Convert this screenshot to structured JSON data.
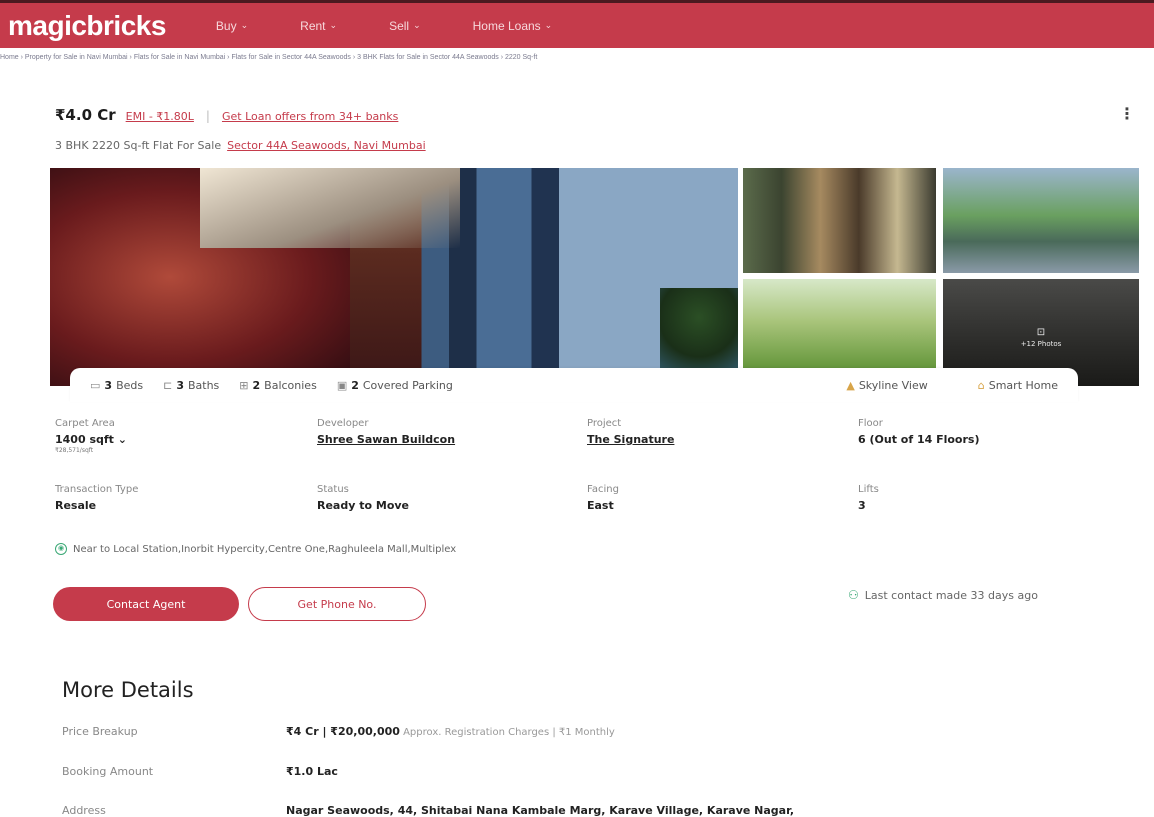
{
  "header": {
    "logo": "magicbricks",
    "nav": [
      {
        "label": "Buy",
        "chevron": "⌄"
      },
      {
        "label": "Rent",
        "chevron": "⌄"
      },
      {
        "label": "Sell",
        "chevron": "⌄"
      },
      {
        "label": "Home Loans",
        "chevron": "⌄"
      }
    ],
    "brand_color": "#c53b4b"
  },
  "breadcrumb": "Home › Property for Sale in Navi Mumbai › Flats for Sale in Navi Mumbai › Flats for Sale in Sector 44A Seawoods › 3 BHK Flats for Sale in Sector 44A Seawoods › 2220 Sq-ft",
  "listing": {
    "price": "₹4.0 Cr",
    "emi": "EMI - ₹1.80L",
    "separator": "|",
    "loan_offer": "Get Loan offers from 34+ banks",
    "menu_icon": "⋮",
    "subtitle": "3 BHK 2220 Sq-ft Flat For Sale",
    "location": "Sector 44A Seawoods, Navi Mumbai"
  },
  "gallery": {
    "more_photos": "+12 Photos",
    "camera_icon": "⊡"
  },
  "amenities": {
    "left": [
      {
        "icon": "bed-icon",
        "glyph": "▭",
        "count": "3",
        "label": "Beds"
      },
      {
        "icon": "bath-icon",
        "glyph": "⊏",
        "count": "3",
        "label": "Baths"
      },
      {
        "icon": "balcony-icon",
        "glyph": "⊞",
        "count": "2",
        "label": "Balconies"
      },
      {
        "icon": "parking-icon",
        "glyph": "▣",
        "count": "2",
        "label": "Covered Parking"
      }
    ],
    "right": [
      {
        "icon": "skyline-icon",
        "glyph": "▲",
        "label": "Skyline View"
      },
      {
        "icon": "smart-home-icon",
        "glyph": "⌂",
        "label": "Smart Home"
      }
    ]
  },
  "facts": [
    {
      "label": "Carpet Area",
      "value": "1400 sqft",
      "suffix": " ⌄",
      "sub": "₹28,571/sqft"
    },
    {
      "label": "Developer",
      "value": "Shree Sawan Buildcon",
      "link": true
    },
    {
      "label": "Project",
      "value": "The Signature",
      "link": true
    },
    {
      "label": "Floor",
      "value": "6 (Out of 14 Floors)"
    },
    {
      "label": "Transaction Type",
      "value": "Resale"
    },
    {
      "label": "Status",
      "value": "Ready to Move"
    },
    {
      "label": "Facing",
      "value": "East"
    },
    {
      "label": "Lifts",
      "value": "3"
    }
  ],
  "nearby": {
    "icon": "◉",
    "text": "Near to Local Station,Inorbit Hypercity,Centre One,Raghuleela Mall,Multiplex"
  },
  "actions": {
    "contact_agent": "Contact Agent",
    "get_phone": "Get Phone No.",
    "last_contact": "Last contact made 33 days ago",
    "person_icon": "⚇"
  },
  "more_details": {
    "title": "More Details",
    "rows": [
      {
        "label": "Price Breakup",
        "value": "₹4 Cr | ₹20,00,000",
        "muted": " Approx. Registration Charges | ₹1 Monthly"
      },
      {
        "label": "Booking Amount",
        "value": "₹1.0 Lac",
        "muted": ""
      },
      {
        "label": "Address",
        "value": "Nagar Seawoods, 44, Shitabai Nana Kambale Marg, Karave Village, Karave Nagar,",
        "muted": ""
      }
    ]
  }
}
